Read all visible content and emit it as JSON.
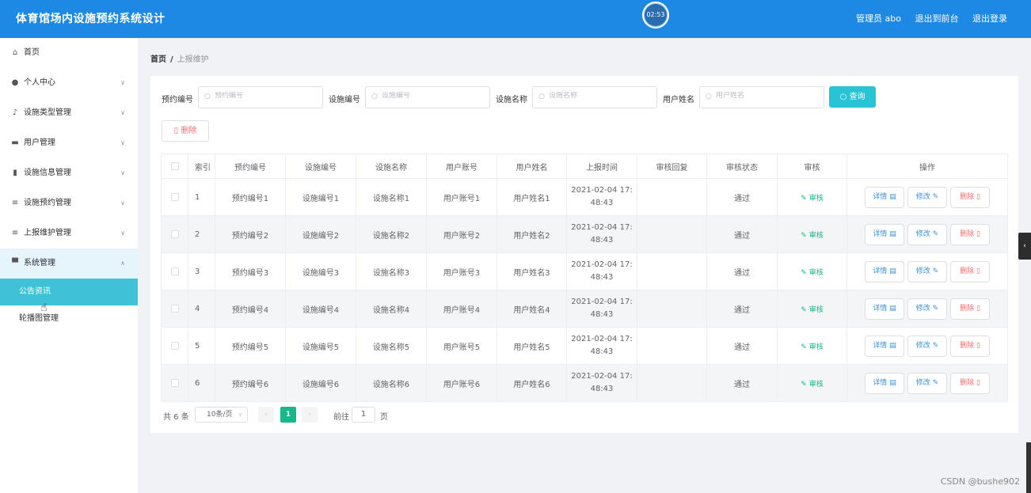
{
  "header": {
    "title": "体育馆场内设施预约系统设计",
    "timer": "02:53",
    "admin": "管理员 abo",
    "back_to_front": "退出到前台",
    "logout": "退出登录"
  },
  "sidebar": {
    "items": [
      {
        "label": "首页",
        "icon": "home-icon",
        "expandable": false
      },
      {
        "label": "个人中心",
        "icon": "user-icon",
        "expandable": true
      },
      {
        "label": "设施类型管理",
        "icon": "mic-icon",
        "expandable": true
      },
      {
        "label": "用户管理",
        "icon": "monitor-icon",
        "expandable": true
      },
      {
        "label": "设施信息管理",
        "icon": "clipboard-icon",
        "expandable": true
      },
      {
        "label": "设施预约管理",
        "icon": "list-icon",
        "expandable": true
      },
      {
        "label": "上报维护管理",
        "icon": "list-icon",
        "expandable": true
      },
      {
        "label": "系统管理",
        "icon": "briefcase-icon",
        "expandable": true
      }
    ],
    "subitems": [
      {
        "label": "公告资讯",
        "active": true
      },
      {
        "label": "轮播图管理",
        "active": false
      }
    ]
  },
  "breadcrumb": {
    "home": "首页",
    "sep": "/",
    "current": "上报维护"
  },
  "search": {
    "fields": [
      {
        "label": "预约编号",
        "placeholder": "预约编号"
      },
      {
        "label": "设施编号",
        "placeholder": "设施编号"
      },
      {
        "label": "设施名称",
        "placeholder": "设施名称"
      },
      {
        "label": "用户姓名",
        "placeholder": "用户姓名"
      }
    ],
    "query_label": "查询"
  },
  "actions": {
    "delete_label": "删除"
  },
  "table": {
    "headers": [
      "",
      "索引",
      "预约编号",
      "设施编号",
      "设施名称",
      "用户账号",
      "用户姓名",
      "上报时间",
      "审核回复",
      "审核状态",
      "审核",
      "操作"
    ],
    "rows": [
      {
        "index": "1",
        "booking_no": "预约编号1",
        "facility_no": "设施编号1",
        "facility_name": "设施名称1",
        "account": "用户账号1",
        "name": "用户姓名1",
        "time_date": "2021-02-04 17:",
        "time_clock": "48:43",
        "reply": "",
        "status": "通过"
      },
      {
        "index": "2",
        "booking_no": "预约编号2",
        "facility_no": "设施编号2",
        "facility_name": "设施名称2",
        "account": "用户账号2",
        "name": "用户姓名2",
        "time_date": "2021-02-04 17:",
        "time_clock": "48:43",
        "reply": "",
        "status": "通过"
      },
      {
        "index": "3",
        "booking_no": "预约编号3",
        "facility_no": "设施编号3",
        "facility_name": "设施名称3",
        "account": "用户账号3",
        "name": "用户姓名3",
        "time_date": "2021-02-04 17:",
        "time_clock": "48:43",
        "reply": "",
        "status": "通过"
      },
      {
        "index": "4",
        "booking_no": "预约编号4",
        "facility_no": "设施编号4",
        "facility_name": "设施名称4",
        "account": "用户账号4",
        "name": "用户姓名4",
        "time_date": "2021-02-04 17:",
        "time_clock": "48:43",
        "reply": "",
        "status": "通过"
      },
      {
        "index": "5",
        "booking_no": "预约编号5",
        "facility_no": "设施编号5",
        "facility_name": "设施名称5",
        "account": "用户账号5",
        "name": "用户姓名5",
        "time_date": "2021-02-04 17:",
        "time_clock": "48:43",
        "reply": "",
        "status": "通过"
      },
      {
        "index": "6",
        "booking_no": "预约编号6",
        "facility_no": "设施编号6",
        "facility_name": "设施名称6",
        "account": "用户账号6",
        "name": "用户姓名6",
        "time_date": "2021-02-04 17:",
        "time_clock": "48:43",
        "reply": "",
        "status": "通过"
      }
    ],
    "audit_label": "审核",
    "detail_label": "详情",
    "edit_label": "修改",
    "delete_label": "删除"
  },
  "pagination": {
    "total": "共 6 条",
    "page_size": "10条/页",
    "current_page": "1",
    "goto_label": "前往",
    "goto_value": "1",
    "page_suffix": "页"
  },
  "watermark": "CSDN @bushe902",
  "colors": {
    "header_bg": "#1e88e5",
    "active_menu": "#3ec2d8",
    "query_btn": "#29c3d6",
    "pager_active": "#13b98b",
    "danger": "#f56c6c"
  }
}
